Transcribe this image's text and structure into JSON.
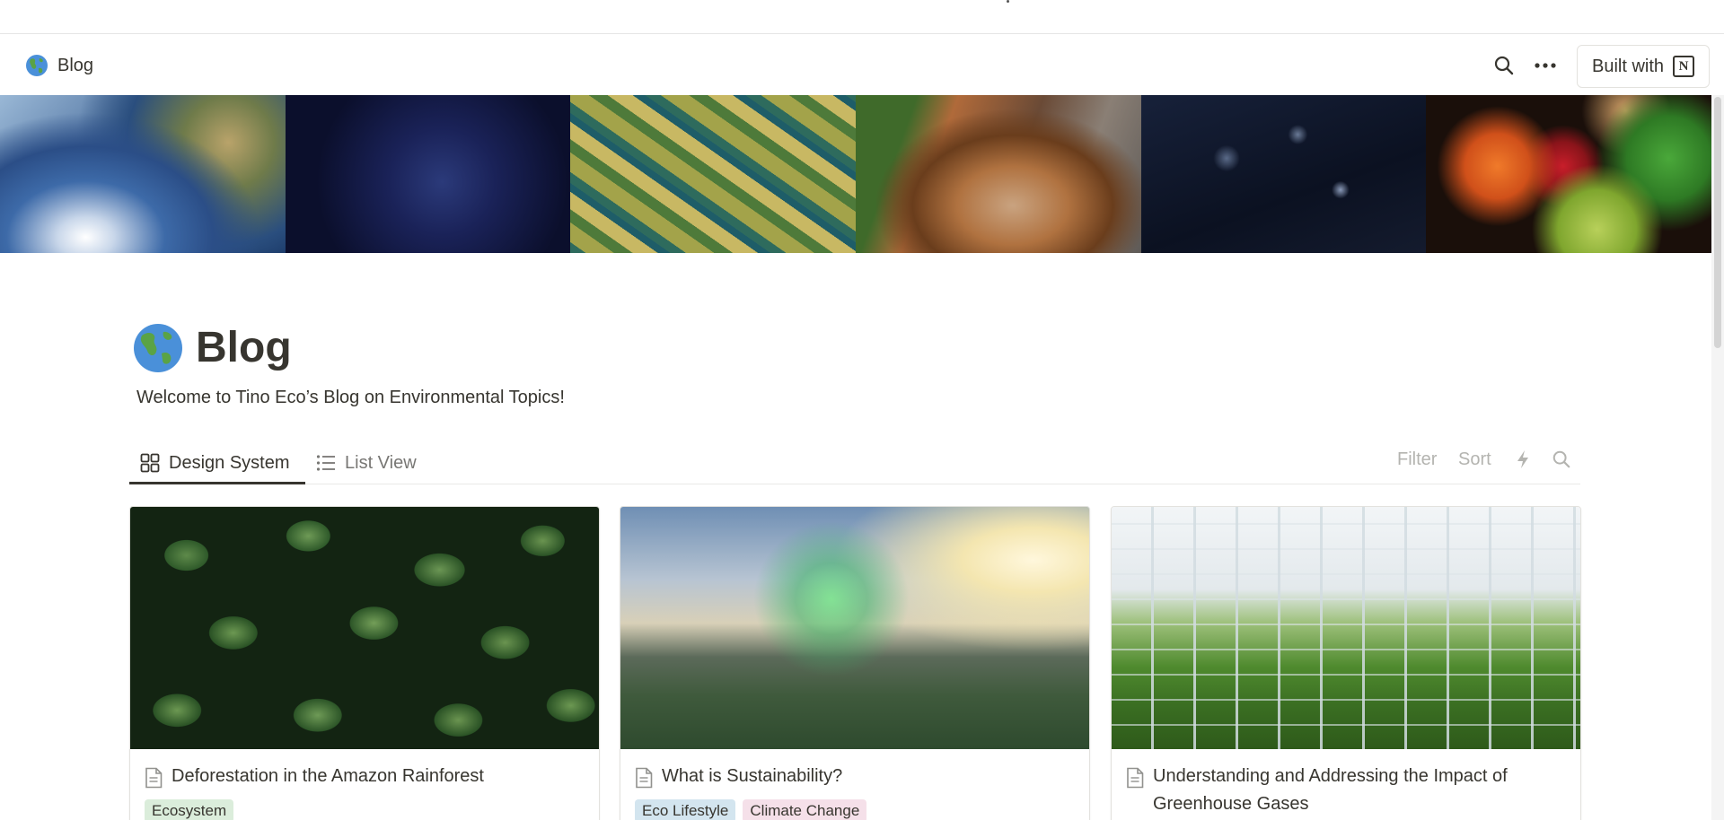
{
  "topbar": {
    "breadcrumb_label": "Blog",
    "built_with_label": "Built with",
    "notion_logo_letter": "N",
    "icons": [
      "globe-icon",
      "search-icon",
      "more-icon",
      "notion-logo-icon"
    ]
  },
  "page": {
    "title": "Blog",
    "description": "Welcome to Tino Eco’s Blog on Environmental Topics!"
  },
  "views": {
    "tabs": [
      {
        "label": "Design System",
        "icon": "gallery-icon",
        "active": true
      },
      {
        "label": "List View",
        "icon": "list-icon",
        "active": false
      }
    ],
    "tools": {
      "filter_label": "Filter",
      "sort_label": "Sort",
      "automation_icon": "lightning-icon",
      "search_icon": "search-icon"
    }
  },
  "cards": [
    {
      "title": "Deforestation in the Amazon Rainforest",
      "tags": [
        {
          "label": "Ecosystem",
          "color": "#dbeddb"
        }
      ]
    },
    {
      "title": "What is Sustainability?",
      "tags": [
        {
          "label": "Eco Lifestyle",
          "color": "#d3e5ef"
        },
        {
          "label": "Climate Change",
          "color": "#f5e0e9"
        }
      ]
    },
    {
      "title": "Understanding and Addressing the Impact of Greenhouse Gases",
      "tags": []
    }
  ],
  "colors": {
    "text": "#37352f",
    "muted": "#787774",
    "faint": "#b4b4b0",
    "border": "#e3e2de"
  }
}
